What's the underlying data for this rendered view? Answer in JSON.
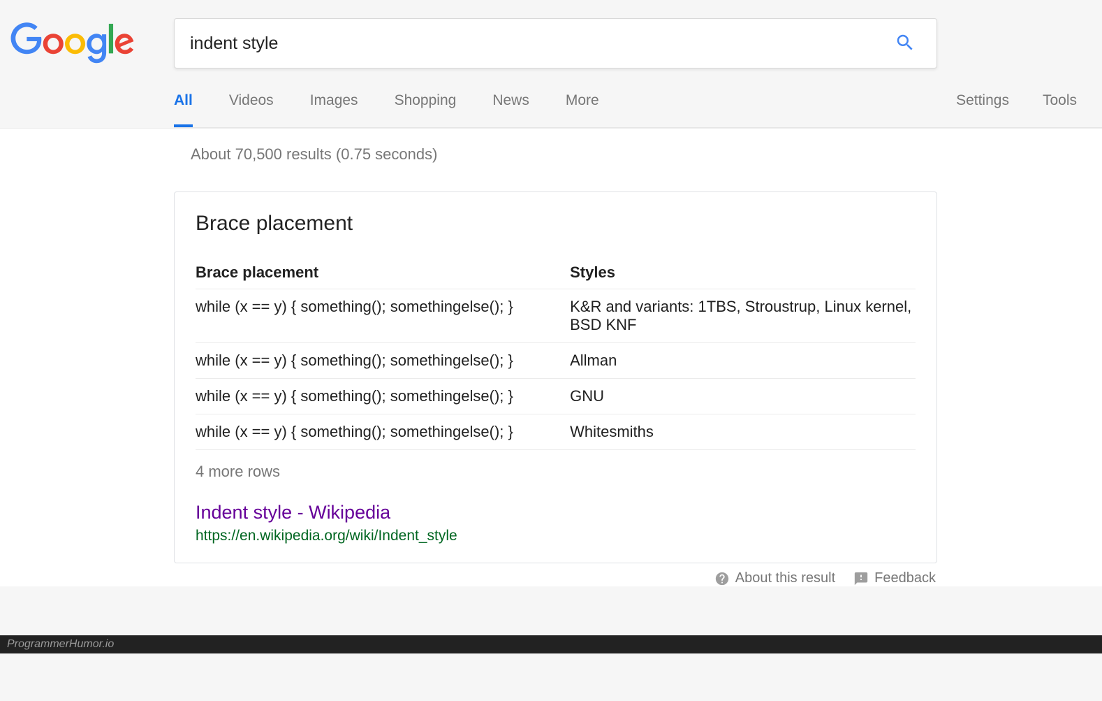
{
  "search": {
    "query": "indent style"
  },
  "nav": {
    "items": [
      "All",
      "Videos",
      "Images",
      "Shopping",
      "News",
      "More"
    ],
    "active_index": 0,
    "settings": "Settings",
    "tools": "Tools"
  },
  "result_stats": "About 70,500 results (0.75 seconds)",
  "answer": {
    "title": "Brace placement",
    "columns": [
      "Brace placement",
      "Styles"
    ],
    "rows": [
      {
        "code": "while (x == y) { something(); somethingelse(); }",
        "style": "K&R and variants: 1TBS, Stroustrup, Linux kernel, BSD KNF"
      },
      {
        "code": "while (x == y) { something(); somethingelse(); }",
        "style": "Allman"
      },
      {
        "code": "while (x == y) { something(); somethingelse(); }",
        "style": "GNU"
      },
      {
        "code": "while (x == y) { something(); somethingelse(); }",
        "style": "Whitesmiths"
      }
    ],
    "more_rows": "4 more rows",
    "source_title": "Indent style - Wikipedia",
    "source_url": "https://en.wikipedia.org/wiki/Indent_style"
  },
  "footer": {
    "about": "About this result",
    "feedback": "Feedback"
  },
  "watermark": "ProgrammerHumor.io"
}
